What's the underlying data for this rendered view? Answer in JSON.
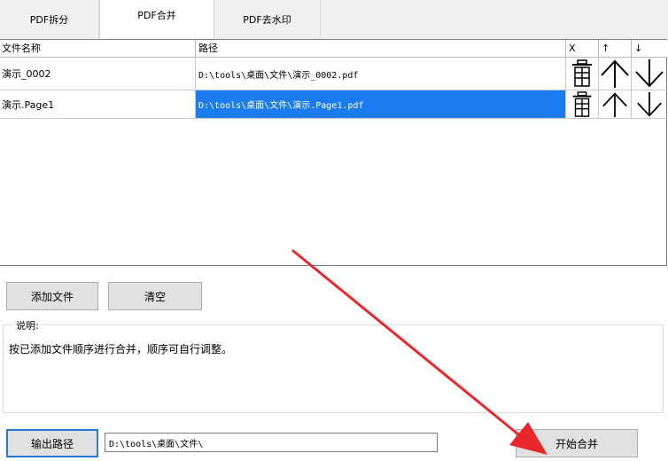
{
  "tabs": [
    {
      "label": "PDF拆分"
    },
    {
      "label": "PDF合并"
    },
    {
      "label": "PDF去水印"
    }
  ],
  "table": {
    "headers": {
      "name": "文件名称",
      "path": "路径",
      "delete": "X",
      "up": "↑",
      "down": "↓"
    },
    "rows": [
      {
        "name": "演示_0002",
        "path": "D:\\tools\\桌面\\文件\\演示_0002.pdf"
      },
      {
        "name": "演示.Page1",
        "path": "D:\\tools\\桌面\\文件\\演示.Page1.pdf"
      }
    ]
  },
  "buttons": {
    "add_file": "添加文件",
    "clear": "清空",
    "output_path": "输出路径",
    "start_merge": "开始合并"
  },
  "instructions": {
    "title": "说明:",
    "text": "按已添加文件顺序进行合并，顺序可自行调整。"
  },
  "output": {
    "path": "D:\\tools\\桌面\\文件\\"
  },
  "icons": {
    "delete": "trash-icon",
    "up": "arrow-up-icon",
    "down": "arrow-down-icon"
  },
  "colors": {
    "selection": "#1a7cf0",
    "annotation_arrow": "#e8282b"
  }
}
